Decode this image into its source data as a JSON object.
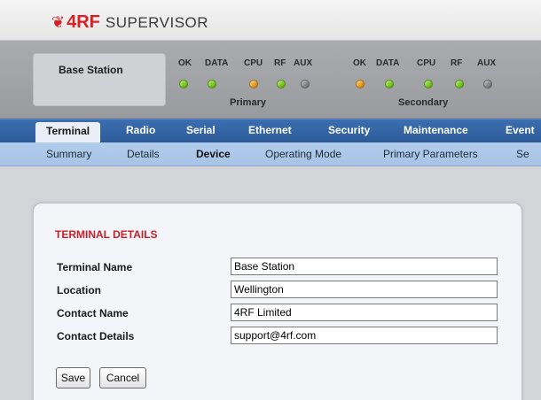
{
  "header": {
    "logo_mark": "❦",
    "logo_brand": "4RF",
    "logo_product": "SUPERVISOR"
  },
  "status": {
    "station_name": "Base Station",
    "primary": {
      "label": "Primary",
      "leds": [
        {
          "label": "OK",
          "color": "#7ed321"
        },
        {
          "label": "DATA",
          "color": "#7ed321"
        },
        {
          "label": "CPU",
          "color": "#f5a623"
        },
        {
          "label": "RF",
          "color": "#7ed321"
        },
        {
          "label": "AUX",
          "color": "#8e8e8e"
        }
      ]
    },
    "secondary": {
      "label": "Secondary",
      "leds": [
        {
          "label": "OK",
          "color": "#f5a623"
        },
        {
          "label": "DATA",
          "color": "#7ed321"
        },
        {
          "label": "CPU",
          "color": "#7ed321"
        },
        {
          "label": "RF",
          "color": "#7ed321"
        },
        {
          "label": "AUX",
          "color": "#8e8e8e"
        }
      ]
    }
  },
  "main_nav": {
    "items": [
      "Terminal",
      "Radio",
      "Serial",
      "Ethernet",
      "Security",
      "Maintenance",
      "Event"
    ],
    "active": "Terminal"
  },
  "sub_nav": {
    "items": [
      "Summary",
      "Details",
      "Device",
      "Operating Mode",
      "Primary Parameters",
      "Se"
    ],
    "active": "Device"
  },
  "form": {
    "title": "TERMINAL DETAILS",
    "fields": [
      {
        "label": "Terminal Name",
        "value": "Base Station"
      },
      {
        "label": "Location",
        "value": "Wellington"
      },
      {
        "label": "Contact Name",
        "value": "4RF Limited"
      },
      {
        "label": "Contact Details",
        "value": "support@4rf.com"
      }
    ],
    "save_label": "Save",
    "cancel_label": "Cancel"
  },
  "colors": {
    "brand_red": "#d81f26",
    "nav_blue": "#2c5a98",
    "subnav_blue": "#a7c3e6",
    "title_red": "#c8202a"
  }
}
